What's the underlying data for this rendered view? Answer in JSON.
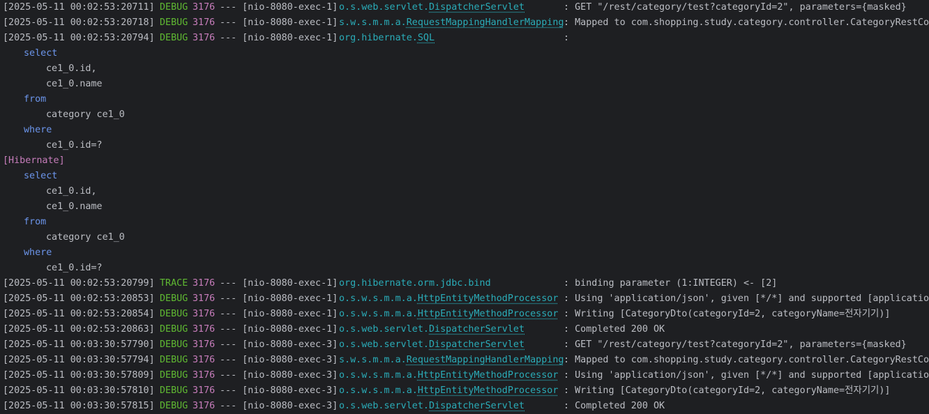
{
  "console": {
    "lines_top": [
      {
        "ts": "[2025-05-11 00:02:53:20711]",
        "level": "DEBUG",
        "pid": "3176",
        "thread": "--- [nio-8080-exec-1]",
        "logger_pre": "o.s.web.servlet.",
        "logger_link": "DispatcherServlet",
        "msg": ": GET \"/rest/category/test?categoryId=2\", parameters={masked}"
      },
      {
        "ts": "[2025-05-11 00:02:53:20718]",
        "level": "DEBUG",
        "pid": "3176",
        "thread": "--- [nio-8080-exec-1]",
        "logger_pre": "s.w.s.m.m.a.",
        "logger_link": "RequestMappingHandlerMapping",
        "msg": ": Mapped to com.shopping.study.category.controller.CategoryRestContr"
      },
      {
        "ts": "[2025-05-11 00:02:53:20794]",
        "level": "DEBUG",
        "pid": "3176",
        "thread": "--- [nio-8080-exec-1]",
        "logger_pre": "org.hibernate.",
        "logger_link": "SQL",
        "msg": ":"
      }
    ],
    "sql_block_1": {
      "select": "select",
      "col1": "ce1_0.id,",
      "col2": "ce1_0.name",
      "from": "from",
      "table": "category ce1_0",
      "where": "where",
      "cond": "ce1_0.id=?"
    },
    "hibernate_tag": "[Hibernate]",
    "sql_block_2": {
      "select": "select",
      "col1": "ce1_0.id,",
      "col2": "ce1_0.name",
      "from": "from",
      "table": "category ce1_0",
      "where": "where",
      "cond": "ce1_0.id=?"
    },
    "lines_bottom": [
      {
        "ts": "[2025-05-11 00:02:53:20799]",
        "level": "TRACE",
        "pid": "3176",
        "thread": "--- [nio-8080-exec-1]",
        "logger_pre": "org.hibernate.orm.jdbc.bind",
        "logger_link": "",
        "msg": ": binding parameter (1:INTEGER) <- [2]"
      },
      {
        "ts": "[2025-05-11 00:02:53:20853]",
        "level": "DEBUG",
        "pid": "3176",
        "thread": "--- [nio-8080-exec-1]",
        "logger_pre": "o.s.w.s.m.m.a.",
        "logger_link": "HttpEntityMethodProcessor",
        "msg": ": Using 'application/json', given [*/*] and supported [application/j"
      },
      {
        "ts": "[2025-05-11 00:02:53:20854]",
        "level": "DEBUG",
        "pid": "3176",
        "thread": "--- [nio-8080-exec-1]",
        "logger_pre": "o.s.w.s.m.m.a.",
        "logger_link": "HttpEntityMethodProcessor",
        "msg": ": Writing [CategoryDto(categoryId=2, categoryName=전자기기)]"
      },
      {
        "ts": "[2025-05-11 00:02:53:20863]",
        "level": "DEBUG",
        "pid": "3176",
        "thread": "--- [nio-8080-exec-1]",
        "logger_pre": "o.s.web.servlet.",
        "logger_link": "DispatcherServlet",
        "msg": ": Completed 200 OK"
      },
      {
        "ts": "[2025-05-11 00:03:30:57790]",
        "level": "DEBUG",
        "pid": "3176",
        "thread": "--- [nio-8080-exec-3]",
        "logger_pre": "o.s.web.servlet.",
        "logger_link": "DispatcherServlet",
        "msg": ": GET \"/rest/category/test?categoryId=2\", parameters={masked}"
      },
      {
        "ts": "[2025-05-11 00:03:30:57794]",
        "level": "DEBUG",
        "pid": "3176",
        "thread": "--- [nio-8080-exec-3]",
        "logger_pre": "s.w.s.m.m.a.",
        "logger_link": "RequestMappingHandlerMapping",
        "msg": ": Mapped to com.shopping.study.category.controller.CategoryRestContr"
      },
      {
        "ts": "[2025-05-11 00:03:30:57809]",
        "level": "DEBUG",
        "pid": "3176",
        "thread": "--- [nio-8080-exec-3]",
        "logger_pre": "o.s.w.s.m.m.a.",
        "logger_link": "HttpEntityMethodProcessor",
        "msg": ": Using 'application/json', given [*/*] and supported [application/j"
      },
      {
        "ts": "[2025-05-11 00:03:30:57810]",
        "level": "DEBUG",
        "pid": "3176",
        "thread": "--- [nio-8080-exec-3]",
        "logger_pre": "o.s.w.s.m.m.a.",
        "logger_link": "HttpEntityMethodProcessor",
        "msg": ": Writing [CategoryDto(categoryId=2, categoryName=전자기기)]"
      },
      {
        "ts": "[2025-05-11 00:03:30:57815]",
        "level": "DEBUG",
        "pid": "3176",
        "thread": "--- [nio-8080-exec-3]",
        "logger_pre": "o.s.web.servlet.",
        "logger_link": "DispatcherServlet",
        "msg": ": Completed 200 OK"
      }
    ]
  }
}
